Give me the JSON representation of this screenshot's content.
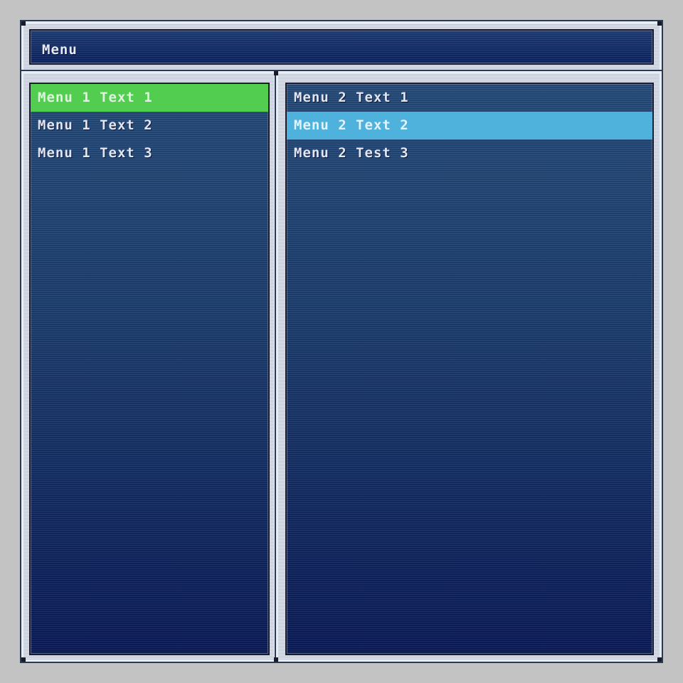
{
  "header": {
    "title": "Menu"
  },
  "menu1": {
    "items": [
      {
        "label": "Menu 1 Text 1",
        "selected": true
      },
      {
        "label": "Menu 1 Text 2",
        "selected": false
      },
      {
        "label": "Menu 1 Text 3",
        "selected": false
      }
    ]
  },
  "menu2": {
    "items": [
      {
        "label": "Menu 2 Text 1",
        "selected": false
      },
      {
        "label": "Menu 2 Text 2",
        "selected": true
      },
      {
        "label": "Menu 2 Test 3",
        "selected": false
      }
    ]
  },
  "colors": {
    "background": "#c3c3c3",
    "panel_top": "#264e7d",
    "panel_bottom": "#0b1c5a",
    "menu1_highlight": "#53cd4f",
    "menu2_highlight": "#4fb2dd",
    "text": "#e2e6ee"
  }
}
